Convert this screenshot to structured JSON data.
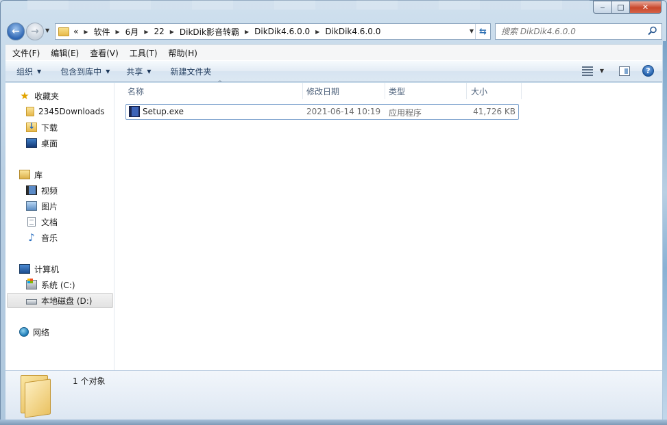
{
  "window": {
    "caption_buttons": {
      "minimize": "‒",
      "maximize": "□",
      "close": "✕"
    }
  },
  "navigation": {
    "back_icon": "back-arrow-icon",
    "forward_icon": "forward-arrow-icon",
    "breadcrumb_overflow": "«",
    "breadcrumbs": [
      "软件",
      "6月",
      "22",
      "DikDik影音转霸",
      "DikDik4.6.0.0",
      "DikDik4.6.0.0"
    ],
    "search_placeholder": "搜索 DikDik4.6.0.0"
  },
  "menu": [
    "文件(F)",
    "编辑(E)",
    "查看(V)",
    "工具(T)",
    "帮助(H)"
  ],
  "toolbar": {
    "organize": "组织",
    "include_in_library": "包含到库中",
    "share": "共享",
    "new_folder": "新建文件夹"
  },
  "sidebar": {
    "favorites": {
      "label": "收藏夹",
      "items": [
        "2345Downloads",
        "下载",
        "桌面"
      ]
    },
    "libraries": {
      "label": "库",
      "items": [
        "视频",
        "图片",
        "文档",
        "音乐"
      ]
    },
    "computer": {
      "label": "计算机",
      "items": [
        "系统 (C:)",
        "本地磁盘 (D:)"
      ]
    },
    "network": {
      "label": "网络"
    }
  },
  "columns": {
    "name": "名称",
    "modified": "修改日期",
    "type": "类型",
    "size": "大小"
  },
  "files": [
    {
      "name": "Setup.exe",
      "modified": "2021-06-14 10:19",
      "type": "应用程序",
      "size": "41,726 KB"
    }
  ],
  "details": {
    "count": "1 个对象"
  },
  "colors": {
    "accent": "#1e395b",
    "selection_border": "#7da2ce",
    "close_button": "#c8472c"
  }
}
